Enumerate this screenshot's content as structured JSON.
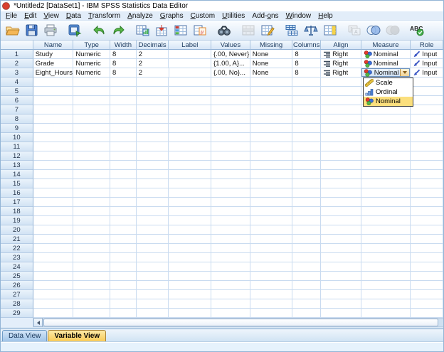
{
  "window": {
    "title": "*Untitled2 [DataSet1] - IBM SPSS Statistics Data Editor"
  },
  "menu": {
    "items": [
      {
        "label": "File",
        "underline": 0
      },
      {
        "label": "Edit",
        "underline": 0
      },
      {
        "label": "View",
        "underline": 0
      },
      {
        "label": "Data",
        "underline": 0
      },
      {
        "label": "Transform",
        "underline": 0
      },
      {
        "label": "Analyze",
        "underline": 0
      },
      {
        "label": "Graphs",
        "underline": 0
      },
      {
        "label": "Custom",
        "underline": 0
      },
      {
        "label": "Utilities",
        "underline": 0
      },
      {
        "label": "Add-ons",
        "underline": 4
      },
      {
        "label": "Window",
        "underline": 0
      },
      {
        "label": "Help",
        "underline": 0
      }
    ]
  },
  "toolbar": {
    "buttons": [
      {
        "icon": "open-data-icon",
        "disabled": false
      },
      {
        "icon": "save-icon",
        "disabled": false
      },
      {
        "icon": "print-icon",
        "disabled": false
      },
      {
        "icon": "recall-dialogs-icon",
        "disabled": false
      },
      {
        "icon": "undo-icon",
        "disabled": false
      },
      {
        "icon": "redo-icon",
        "disabled": false
      },
      {
        "icon": "goto-chart-icon",
        "disabled": false
      },
      {
        "icon": "goto-case-icon",
        "disabled": false
      },
      {
        "icon": "goto-variable-icon",
        "disabled": false
      },
      {
        "icon": "variables-info-icon",
        "disabled": false
      },
      {
        "icon": "find-icon",
        "disabled": false
      },
      {
        "icon": "insert-cases-icon",
        "disabled": true
      },
      {
        "icon": "insert-variable-icon",
        "disabled": false
      },
      {
        "icon": "split-file-icon",
        "disabled": false
      },
      {
        "icon": "weight-cases-icon",
        "disabled": false
      },
      {
        "icon": "select-cases-icon",
        "disabled": false
      },
      {
        "icon": "value-labels-icon",
        "disabled": true
      },
      {
        "icon": "use-variable-sets-icon",
        "disabled": false
      },
      {
        "icon": "show-all-variables-icon",
        "disabled": true
      },
      {
        "icon": "spell-check-icon",
        "disabled": false
      }
    ]
  },
  "grid": {
    "columns": [
      "Name",
      "Type",
      "Width",
      "Decimals",
      "Label",
      "Values",
      "Missing",
      "Columns",
      "Align",
      "Measure",
      "Role"
    ],
    "row_numbers": [
      "1",
      "2",
      "3",
      "4",
      "5",
      "6",
      "7",
      "8",
      "9",
      "10",
      "11",
      "12",
      "13",
      "14",
      "15",
      "16",
      "17",
      "18",
      "19",
      "20",
      "21",
      "22",
      "23",
      "24",
      "25",
      "26",
      "27",
      "28",
      "29"
    ],
    "rows": [
      {
        "num": "1",
        "name": "Study",
        "type": "Numeric",
        "width": "8",
        "decimals": "2",
        "label": "",
        "values": "{.00, Never}...",
        "missing": "None",
        "columns": "8",
        "align": "Right",
        "measure": "Nominal",
        "role": "Input"
      },
      {
        "num": "2",
        "name": "Grade",
        "type": "Numeric",
        "width": "8",
        "decimals": "2",
        "label": "",
        "values": "{1.00, A}...",
        "missing": "None",
        "columns": "8",
        "align": "Right",
        "measure": "Nominal",
        "role": "Input"
      },
      {
        "num": "3",
        "name": "Eight_Hours...",
        "type": "Numeric",
        "width": "8",
        "decimals": "2",
        "label": "",
        "values": "{.00, No}...",
        "missing": "None",
        "columns": "8",
        "align": "Right",
        "measure": "Nominal",
        "role": "Input"
      }
    ]
  },
  "measure_dropdown": {
    "selected": "Nominal",
    "options": [
      {
        "label": "Scale",
        "icon": "scale-icon",
        "highlighted": false
      },
      {
        "label": "Ordinal",
        "icon": "ordinal-icon",
        "highlighted": false
      },
      {
        "label": "Nominal",
        "icon": "nominal-icon",
        "highlighted": true
      }
    ]
  },
  "tabs": [
    {
      "label": "Data View",
      "active": false
    },
    {
      "label": "Variable View",
      "active": true
    }
  ],
  "status_bar": {
    "text": ""
  },
  "colors": {
    "active_tab": "#f8c953",
    "dropdown_highlight": "#fbdf7d",
    "grid_line": "#c9dbf0",
    "header_text": "#1c3a5e"
  }
}
